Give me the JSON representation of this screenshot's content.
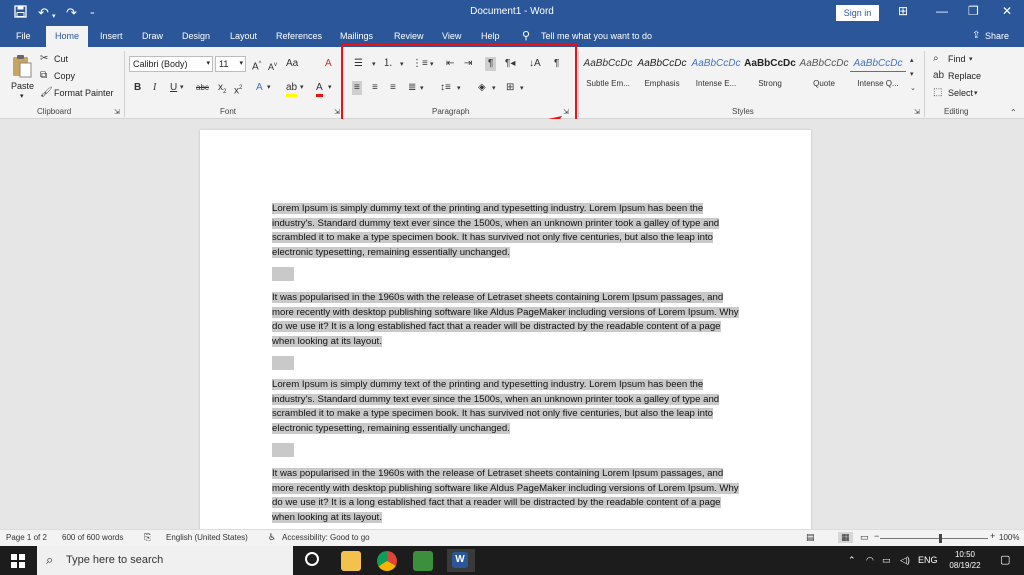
{
  "titlebar": {
    "doc_title": "Document1 - Word",
    "signin": "Sign in",
    "save_icon": "save-icon",
    "undo_icon": "undo-icon",
    "redo_icon": "redo-icon"
  },
  "tabs": {
    "file": "File",
    "home": "Home",
    "insert": "Insert",
    "draw": "Draw",
    "design": "Design",
    "layout": "Layout",
    "references": "References",
    "mailings": "Mailings",
    "review": "Review",
    "view": "View",
    "help": "Help",
    "tellme": "Tell me what you want to do",
    "share": "Share"
  },
  "clipboard": {
    "paste": "Paste",
    "cut": "Cut",
    "copy": "Copy",
    "format_painter": "Format Painter",
    "label": "Clipboard"
  },
  "font": {
    "name": "Calibri (Body)",
    "size": "11",
    "label": "Font"
  },
  "paragraph": {
    "label": "Paragraph"
  },
  "styles": {
    "items": [
      {
        "preview": "AaBbCcDc",
        "name": "Subtle Em..."
      },
      {
        "preview": "AaBbCcDc",
        "name": "Emphasis"
      },
      {
        "preview": "AaBbCcDc",
        "name": "Intense E..."
      },
      {
        "preview": "AaBbCcDc",
        "name": "Strong"
      },
      {
        "preview": "AaBbCcDc",
        "name": "Quote"
      },
      {
        "preview": "AaBbCcDc",
        "name": "Intense Q..."
      }
    ],
    "label": "Styles"
  },
  "editing": {
    "find": "Find",
    "replace": "Replace",
    "select": "Select",
    "label": "Editing"
  },
  "document": {
    "p1": "Lorem Ipsum is simply dummy text of the printing and typesetting industry. Lorem Ipsum has been the industry's. Standard dummy text ever since the 1500s, when an unknown printer took a galley of type and scrambled it to make a type specimen book. It has survived not only five centuries, but also the leap into electronic typesetting, remaining essentially unchanged.",
    "p2": "It was popularised in the 1960s with the release of Letraset sheets containing Lorem Ipsum passages, and more recently with desktop publishing software like Aldus PageMaker including versions of Lorem Ipsum. Why do we use it? It is a long established fact that a reader will be distracted by the readable content of a page when looking at its layout.",
    "p3": "Lorem Ipsum is simply dummy text of the printing and typesetting industry. Lorem Ipsum has been the industry's. Standard dummy text ever since the 1500s, when an unknown printer took a galley of type and scrambled it to make a type specimen book. It has survived not only five centuries, but also the leap into electronic typesetting, remaining essentially unchanged.",
    "p4": "It was popularised in the 1960s with the release of Letraset sheets containing Lorem Ipsum passages, and more recently with desktop publishing software like Aldus PageMaker including versions of Lorem Ipsum. Why do we use it? It is a long established fact that a reader will be distracted by the readable content of a page when looking at its layout."
  },
  "status": {
    "page": "Page 1 of 2",
    "words": "600 of 600 words",
    "language": "English (United States)",
    "accessibility": "Accessibility: Good to go",
    "zoom": "100%",
    "zoom_level": 1.0
  },
  "taskbar": {
    "search_placeholder": "Type here to search",
    "lang": "ENG",
    "time": "10:50",
    "date": "08/19/22"
  },
  "colors": {
    "accent": "#2b579a",
    "highlight_box": "#ee1111"
  }
}
